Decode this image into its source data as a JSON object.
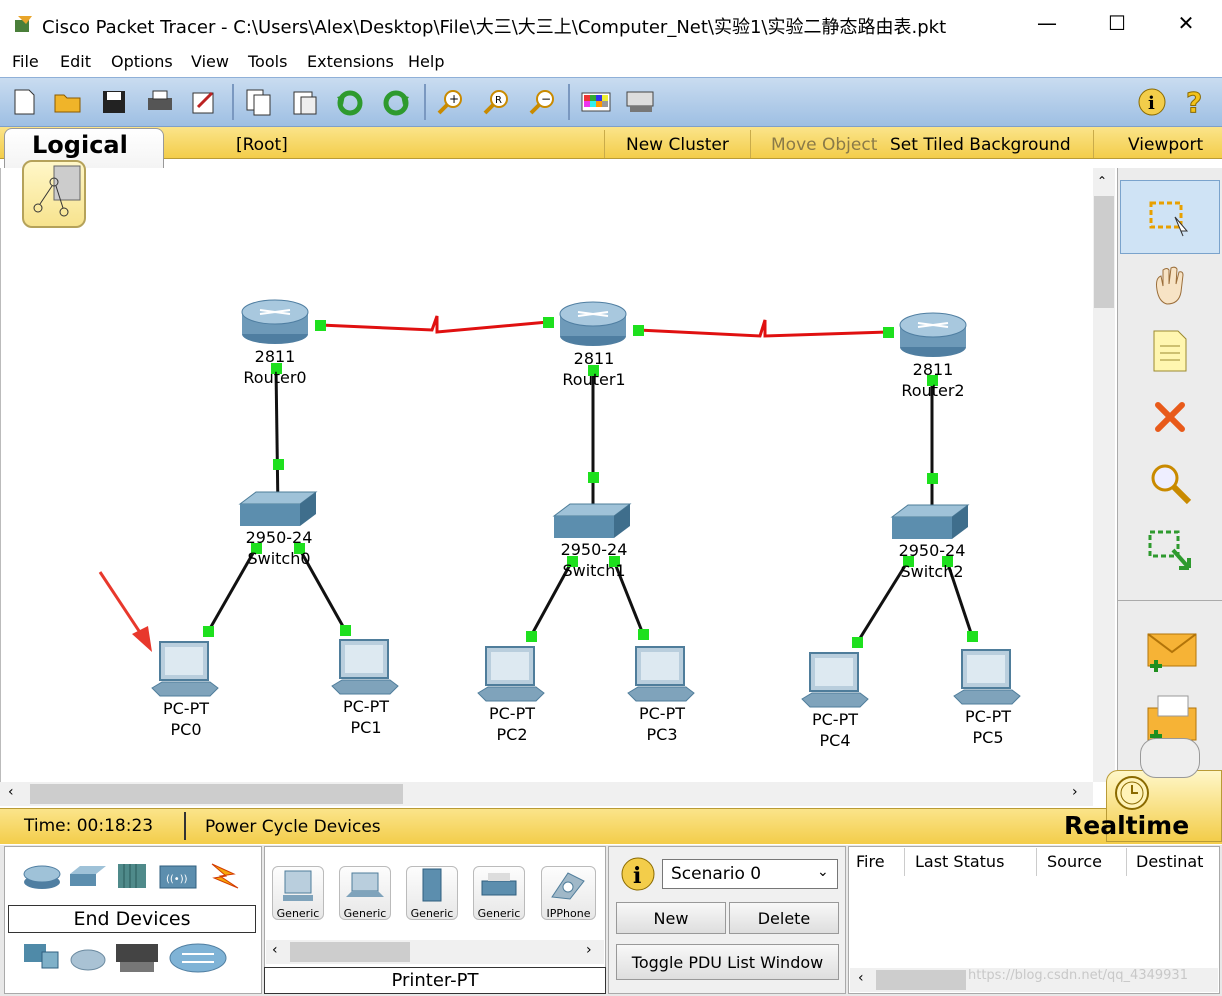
{
  "window": {
    "title": "Cisco Packet Tracer - C:\\Users\\Alex\\Desktop\\File\\大三\\大三上\\Computer_Net\\实验1\\实验二静态路由表.pkt",
    "minimize": "—",
    "maximize": "☐",
    "close": "✕"
  },
  "menu": [
    "File",
    "Edit",
    "Options",
    "View",
    "Tools",
    "Extensions",
    "Help"
  ],
  "logical_bar": {
    "tab": "Logical",
    "root": "[Root]",
    "new_cluster": "New Cluster",
    "move_object": "Move Object",
    "set_tiled_background": "Set Tiled Background",
    "viewport": "Viewport"
  },
  "routers": [
    {
      "model": "2811",
      "name": "Router0"
    },
    {
      "model": "2811",
      "name": "Router1"
    },
    {
      "model": "2811",
      "name": "Router2"
    }
  ],
  "switches": [
    {
      "model": "2950-24",
      "name": "Switch0"
    },
    {
      "model": "2950-24",
      "name": "Switch1"
    },
    {
      "model": "2950-24",
      "name": "Switch2"
    }
  ],
  "pcs": [
    {
      "model": "PC-PT",
      "name": "PC0"
    },
    {
      "model": "PC-PT",
      "name": "PC1"
    },
    {
      "model": "PC-PT",
      "name": "PC2"
    },
    {
      "model": "PC-PT",
      "name": "PC3"
    },
    {
      "model": "PC-PT",
      "name": "PC4"
    },
    {
      "model": "PC-PT",
      "name": "PC5"
    }
  ],
  "status": {
    "time": "Time: 00:18:23",
    "power_cycle": "Power Cycle Devices",
    "mode": "Realtime"
  },
  "device_panel": {
    "category": "End Devices",
    "devices": [
      "Generic",
      "Generic",
      "Generic",
      "Generic",
      "IPPhone"
    ],
    "selected": "Printer-PT"
  },
  "scenario": {
    "selected": "Scenario 0",
    "new": "New",
    "delete": "Delete",
    "toggle": "Toggle PDU List Window"
  },
  "pdu_columns": [
    "Fire",
    "Last Status",
    "Source",
    "Destinat"
  ],
  "watermark": "https://blog.csdn.net/qq_4349931"
}
